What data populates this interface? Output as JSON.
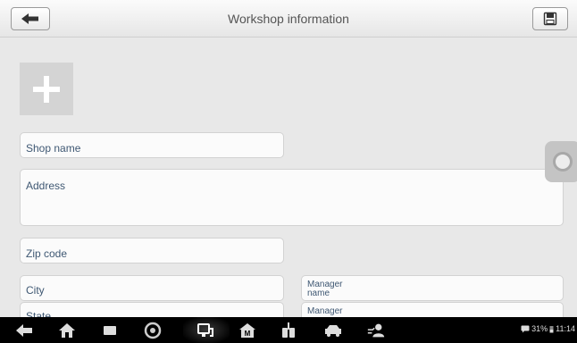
{
  "header": {
    "title": "Workshop information"
  },
  "form": {
    "shop_name": "Shop name",
    "address": "Address",
    "zip_code": "Zip code",
    "city": "City",
    "state": "State",
    "manager_name": "Manager\nname",
    "manager_2": "Manager"
  },
  "statusbar": {
    "battery": "31%",
    "time": "11:14"
  },
  "icons": {
    "back": "arrow-left-icon",
    "save": "save-icon",
    "add": "plus-icon",
    "nav": [
      "back-icon",
      "home-icon",
      "recent-apps-icon",
      "browser-icon",
      "vci-icon",
      "autel-home-icon",
      "multimeter-icon",
      "car-icon",
      "remote-expert-icon"
    ]
  },
  "colors": {
    "background": "#e8e8e8",
    "label": "#3f5873",
    "navbar": "#000000",
    "field": "#fbfbfb"
  }
}
